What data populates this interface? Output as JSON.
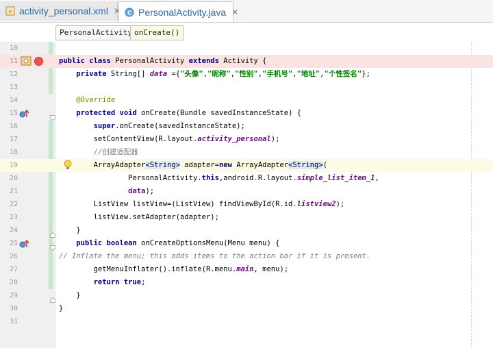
{
  "tabs": [
    {
      "label": "activity_personal.xml",
      "icon": "xml-file-icon",
      "active": false
    },
    {
      "label": "PersonalActivity.java",
      "icon": "java-class-icon",
      "active": true
    }
  ],
  "breadcrumb": [
    "PersonalActivity",
    "onCreate()"
  ],
  "colors": {
    "keyword": "#000080",
    "string": "#008000",
    "annotation": "#808000",
    "comment": "#808080",
    "field": "#660e7a"
  },
  "line_numbers": [
    "10",
    "11",
    "12",
    "13",
    "14",
    "15",
    "16",
    "17",
    "18",
    "19",
    "20",
    "21",
    "22",
    "23",
    "24",
    "25",
    "26",
    "27",
    "28",
    "29",
    "30",
    "31"
  ],
  "code": {
    "l11": {
      "kw1": "public class",
      "name": "PersonalActivity",
      "kw2": "extends",
      "rest": "Activity {"
    },
    "l12": {
      "kw": "private",
      "type": "String[]",
      "field": "data",
      "eq": "={",
      "s1": "\"头像\"",
      "s2": "\"昵称\"",
      "s3": "\"性别\"",
      "s4": "\"手机号\"",
      "s5": "\"地址\"",
      "s6": "\"个性签名\"",
      "end": "};",
      "comma": ","
    },
    "l14": "@Override",
    "l15": {
      "kw": "protected void",
      "rest": "onCreate(Bundle savedInstanceState) {"
    },
    "l16": {
      "kw": "super",
      "rest": ".onCreate(savedInstanceState);"
    },
    "l17": {
      "pre": "setContentView(R.layout.",
      "field": "activity_personal",
      "post": ");"
    },
    "l18": "//创建适配器",
    "l19": {
      "pre": "ArrayAdapter",
      "g1": "<String>",
      "mid": " adapter=",
      "kw": "new",
      "post": " ArrayAdapter",
      "g2": "<String>",
      "end": "("
    },
    "l20": {
      "pre": "PersonalActivity.",
      "kw": "this",
      "mid": ",android.R.layout.",
      "field": "simple_list_item_1",
      "post": ","
    },
    "l21": {
      "field": "data",
      "post": ");"
    },
    "l22": {
      "pre": "ListView listView=(ListView) findViewById(R.id.",
      "field": "listview2",
      "post": ");"
    },
    "l23": "listView.setAdapter(adapter);",
    "l24": "}",
    "l25": {
      "kw": "public boolean",
      "rest": "onCreateOptionsMenu(Menu menu) {"
    },
    "l26": "// Inflate the menu; this adds items to the action bar if it is present.",
    "l27": {
      "pre": "getMenuInflater().inflate(R.menu.",
      "field": "main",
      "post": ", menu);"
    },
    "l28": {
      "kw": "return true",
      "post": ";"
    },
    "l29": "}",
    "l30": "}"
  }
}
